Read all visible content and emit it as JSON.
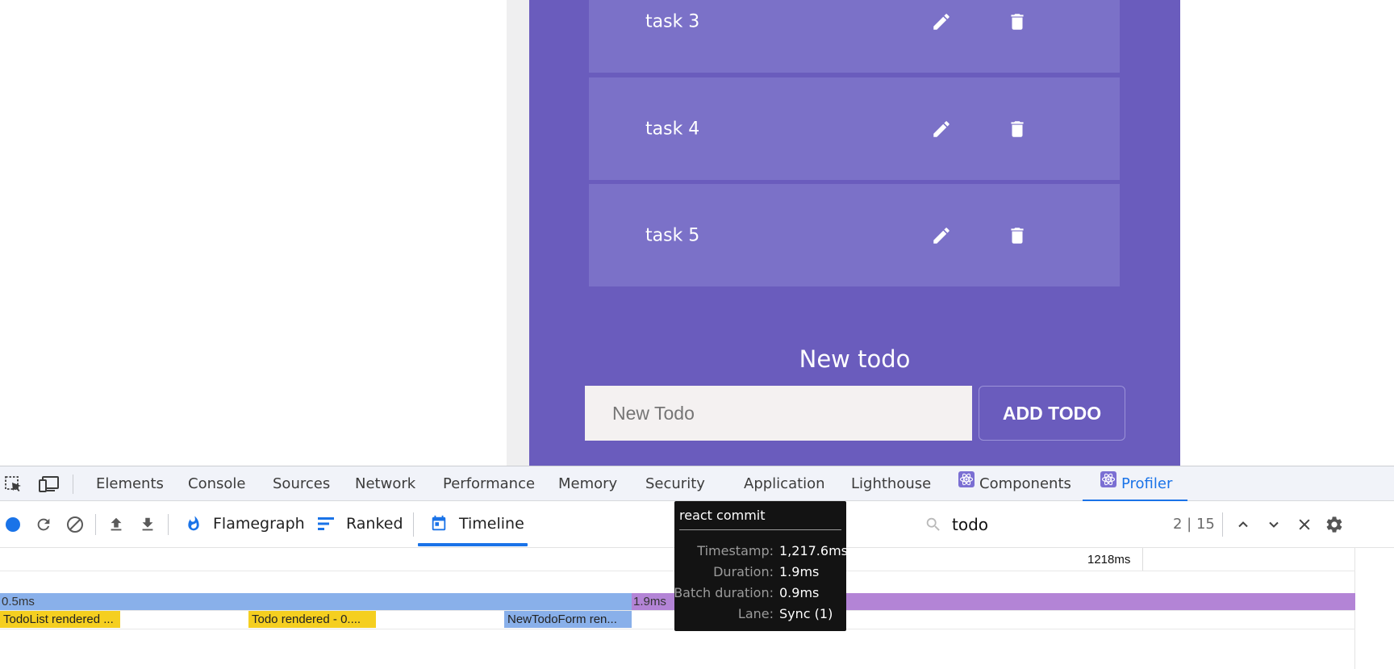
{
  "app": {
    "todos": [
      {
        "label": "task 3"
      },
      {
        "label": "task 4"
      },
      {
        "label": "task 5"
      }
    ],
    "new_todo_title": "New todo",
    "new_todo_placeholder": "New Todo",
    "add_button_label": "ADD TODO",
    "colors": {
      "accent": "#6a5cbd",
      "card": "#7b71c8"
    }
  },
  "devtools": {
    "tabs": [
      {
        "label": "Elements"
      },
      {
        "label": "Console"
      },
      {
        "label": "Sources"
      },
      {
        "label": "Network"
      },
      {
        "label": "Performance"
      },
      {
        "label": "Memory"
      },
      {
        "label": "Security"
      },
      {
        "label": "Application"
      },
      {
        "label": "Lighthouse"
      },
      {
        "label": "Components",
        "icon": "react-icon"
      },
      {
        "label": "Profiler",
        "icon": "react-icon",
        "active": true
      }
    ],
    "profiler": {
      "views": [
        {
          "label": "Flamegraph",
          "icon": "flame-icon"
        },
        {
          "label": "Ranked",
          "icon": "ranked-icon"
        },
        {
          "label": "Timeline",
          "icon": "calendar-icon",
          "active": true
        }
      ],
      "search_value": "todo",
      "search_count": "2 | 15",
      "timeline": {
        "tick_label": "1218ms",
        "commit_bars": [
          {
            "label": "0.5ms",
            "color": "#89b0ea"
          },
          {
            "label": "1.9ms",
            "color": "#b384d6"
          }
        ],
        "component_bars": [
          {
            "label": "TodoList rendered ...",
            "color": "#f5cf20"
          },
          {
            "label": "Todo rendered - 0....",
            "color": "#f5cf20"
          },
          {
            "label": "NewTodoForm ren...",
            "color": "#89b0ea"
          }
        ]
      },
      "tooltip": {
        "title": "react commit",
        "rows": [
          {
            "key": "Timestamp:",
            "value": "1,217.6ms"
          },
          {
            "key": "Duration:",
            "value": "1.9ms"
          },
          {
            "key": "Batch duration:",
            "value": "0.9ms"
          },
          {
            "key": "Lane:",
            "value": "Sync (1)"
          }
        ]
      }
    }
  }
}
